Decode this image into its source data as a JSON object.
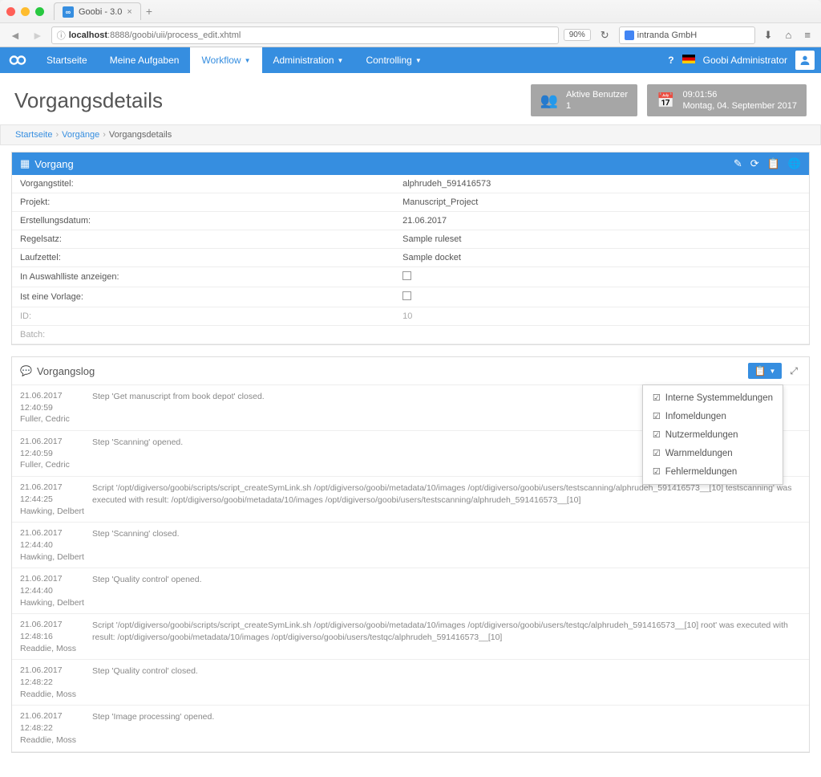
{
  "browser": {
    "tab_title": "Goobi - 3.0",
    "url_host": "localhost",
    "url_path": ":8888/goobi/uii/process_edit.xhtml",
    "zoom": "90%",
    "search_placeholder": "intranda GmbH"
  },
  "nav": {
    "items": [
      {
        "label": "Startseite"
      },
      {
        "label": "Meine Aufgaben"
      },
      {
        "label": "Workflow",
        "active": true,
        "caret": true
      },
      {
        "label": "Administration",
        "caret": true
      },
      {
        "label": "Controlling",
        "caret": true
      }
    ],
    "user_label": "Goobi Administrator"
  },
  "page": {
    "title": "Vorgangsdetails",
    "active_users_label": "Aktive Benutzer",
    "active_users_count": "1",
    "clock_time": "09:01:56",
    "clock_date": "Montag, 04. September 2017"
  },
  "breadcrumb": [
    "Startseite",
    "Vorgänge",
    "Vorgangsdetails"
  ],
  "vorgang_panel": {
    "title": "Vorgang",
    "rows": [
      {
        "label": "Vorgangstitel:",
        "value": "alphrudeh_591416573"
      },
      {
        "label": "Projekt:",
        "value": "Manuscript_Project"
      },
      {
        "label": "Erstellungsdatum:",
        "value": "21.06.2017"
      },
      {
        "label": "Regelsatz:",
        "value": "Sample ruleset"
      },
      {
        "label": "Laufzettel:",
        "value": "Sample docket"
      },
      {
        "label": "In Auswahlliste anzeigen:",
        "checkbox": true
      },
      {
        "label": "Ist eine Vorlage:",
        "checkbox": true
      },
      {
        "label": "ID:",
        "value": "10",
        "muted": true
      },
      {
        "label": "Batch:",
        "value": "",
        "muted": true
      }
    ]
  },
  "log_panel": {
    "title": "Vorgangslog",
    "entries": [
      {
        "date": "21.06.2017",
        "time": "12:40:59",
        "user": "Fuller, Cedric",
        "msg": "Step 'Get manuscript from book depot' closed."
      },
      {
        "date": "21.06.2017",
        "time": "12:40:59",
        "user": "Fuller, Cedric",
        "msg": "Step 'Scanning' opened."
      },
      {
        "date": "21.06.2017",
        "time": "12:44:25",
        "user": "Hawking, Delbert",
        "msg": "Script '/opt/digiverso/goobi/scripts/script_createSymLink.sh /opt/digiverso/goobi/metadata/10/images /opt/digiverso/goobi/users/testscanning/alphrudeh_591416573__[10] testscanning' was executed with result: /opt/digiverso/goobi/metadata/10/images /opt/digiverso/goobi/users/testscanning/alphrudeh_591416573__[10]"
      },
      {
        "date": "21.06.2017",
        "time": "12:44:40",
        "user": "Hawking, Delbert",
        "msg": "Step 'Scanning' closed."
      },
      {
        "date": "21.06.2017",
        "time": "12:44:40",
        "user": "Hawking, Delbert",
        "msg": "Step 'Quality control' opened."
      },
      {
        "date": "21.06.2017",
        "time": "12:48:16",
        "user": "Readdie, Moss",
        "msg": "Script '/opt/digiverso/goobi/scripts/script_createSymLink.sh /opt/digiverso/goobi/metadata/10/images /opt/digiverso/goobi/users/testqc/alphrudeh_591416573__[10] root' was executed with result: /opt/digiverso/goobi/metadata/10/images /opt/digiverso/goobi/users/testqc/alphrudeh_591416573__[10]"
      },
      {
        "date": "21.06.2017",
        "time": "12:48:22",
        "user": "Readdie, Moss",
        "msg": "Step 'Quality control' closed."
      },
      {
        "date": "21.06.2017",
        "time": "12:48:22",
        "user": "Readdie, Moss",
        "msg": "Step 'Image processing' opened."
      }
    ],
    "dropdown": [
      "Interne Systemmeldungen",
      "Infomeldungen",
      "Nutzermeldungen",
      "Warnmeldungen",
      "Fehlermeldungen"
    ]
  }
}
